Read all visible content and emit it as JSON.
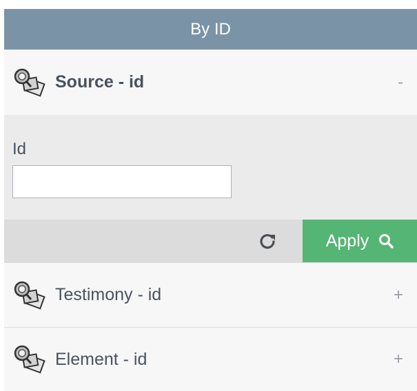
{
  "header": {
    "title": "By ID"
  },
  "sections": [
    {
      "title": "Source - id",
      "toggle": "-",
      "icon": "search-documents-icon",
      "expanded": true
    },
    {
      "title": "Testimony - id",
      "toggle": "+",
      "icon": "search-documents-icon",
      "expanded": false
    },
    {
      "title": "Element - id",
      "toggle": "+",
      "icon": "search-documents-icon",
      "expanded": false
    }
  ],
  "source_form": {
    "id_label": "Id",
    "id_value": "",
    "id_placeholder": ""
  },
  "actions": {
    "reset_icon": "refresh-icon",
    "apply_label": "Apply",
    "apply_icon": "search-icon"
  },
  "colors": {
    "header_bg": "#7b93a6",
    "apply_bg": "#55b574",
    "body_bg": "#ebebeb",
    "actions_bg": "#dcdcdc"
  }
}
